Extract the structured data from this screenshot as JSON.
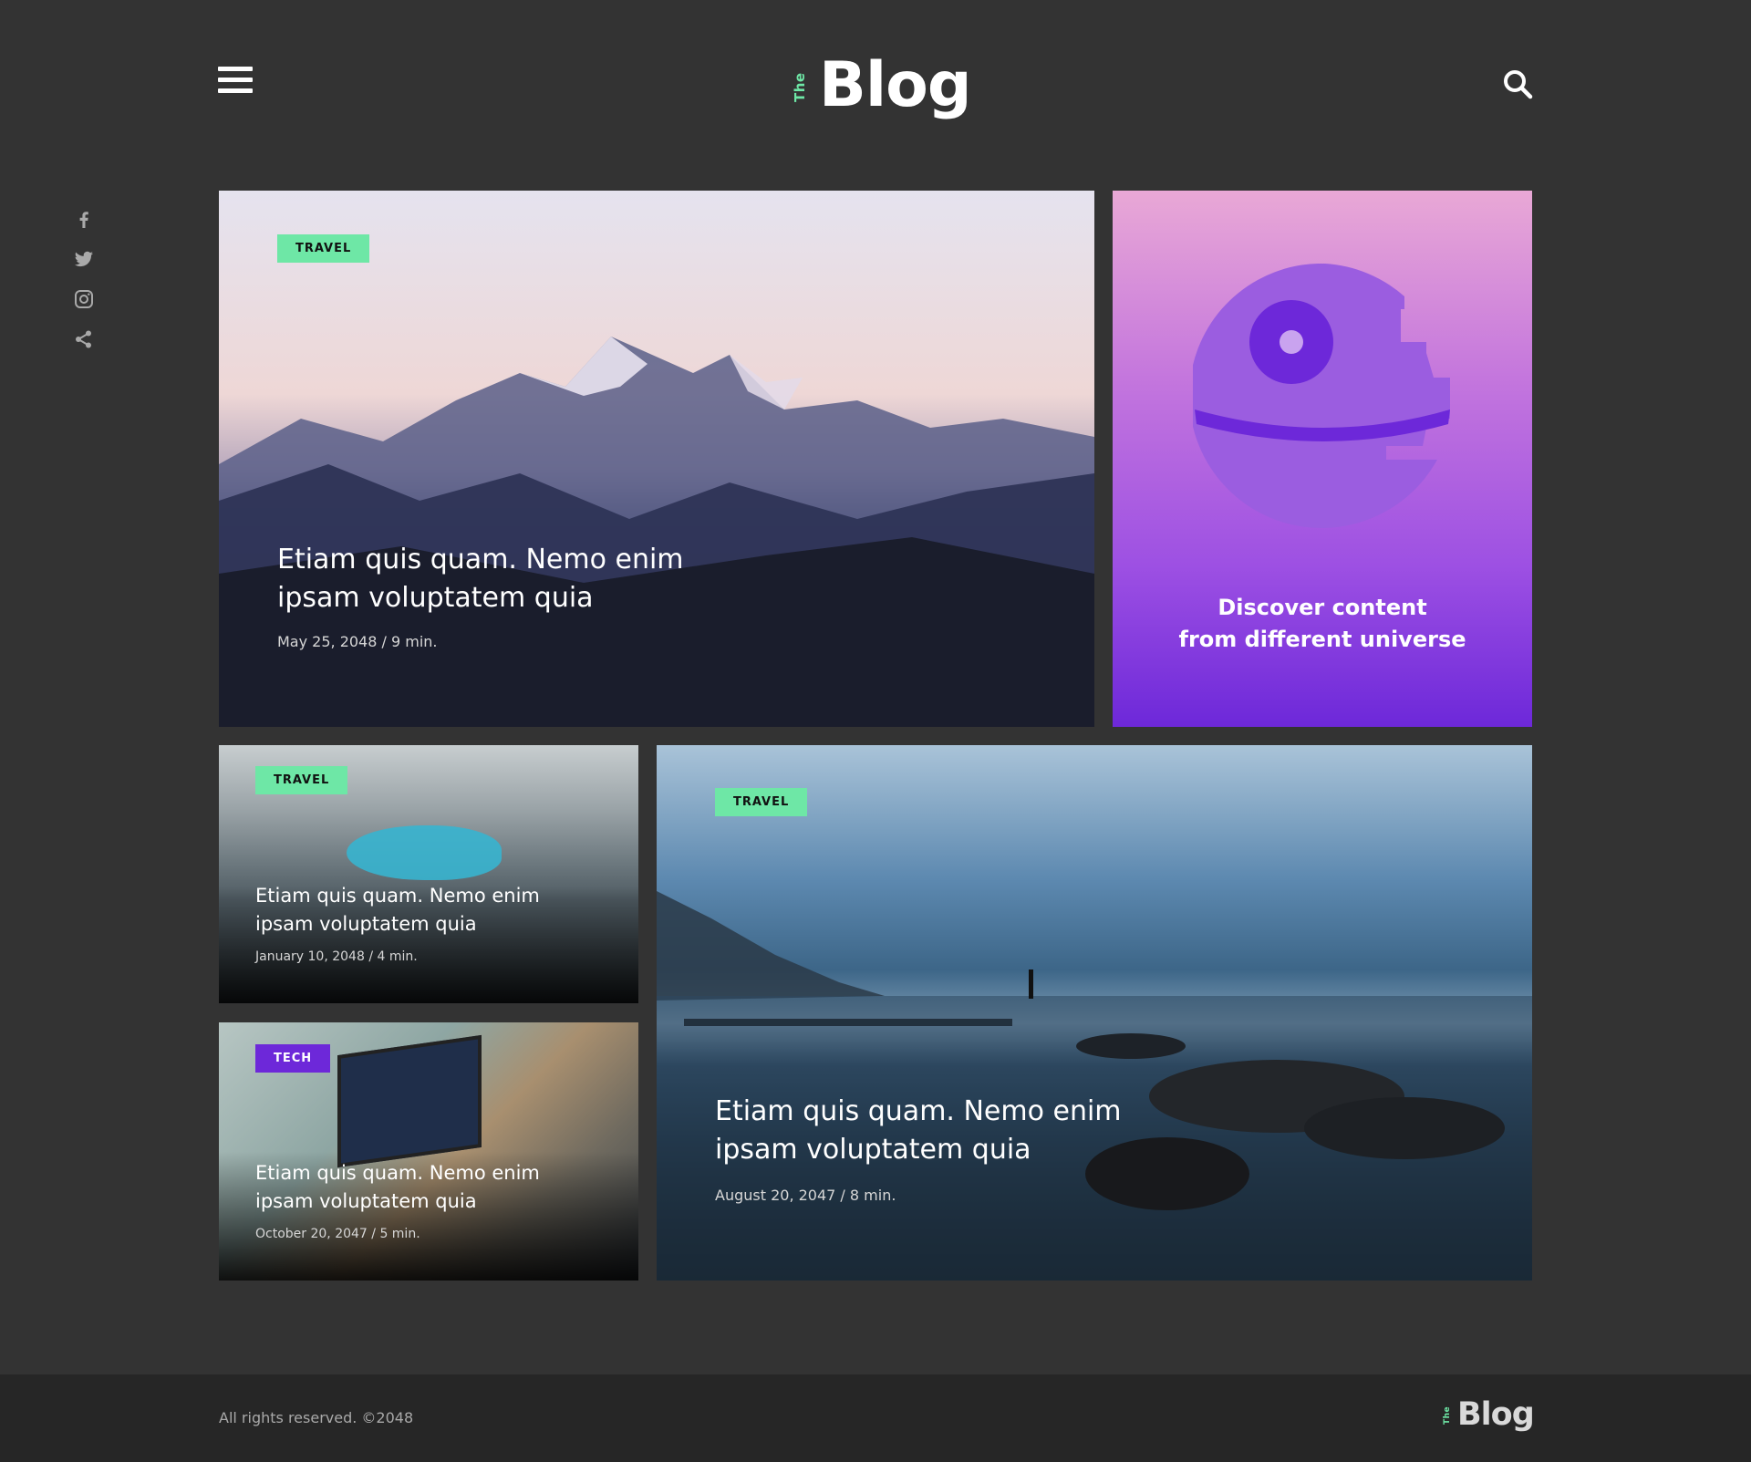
{
  "header": {
    "logo_small": "The",
    "logo_main": "Blog"
  },
  "social": [
    "facebook-icon",
    "twitter-icon",
    "instagram-icon",
    "share-icon"
  ],
  "posts": [
    {
      "category": "TRAVEL",
      "title": "Etiam quis quam. Nemo enim ipsam voluptatem quia",
      "meta": "May 25, 2048 / 9 min."
    },
    {
      "category": "TRAVEL",
      "title": "Etiam quis quam. Nemo enim ipsam voluptatem quia",
      "meta": "January 10, 2048 / 4 min."
    },
    {
      "category": "TECH",
      "title": "Etiam quis quam. Nemo enim ipsam voluptatem quia",
      "meta": "October 20, 2047 / 5 min."
    },
    {
      "category": "TRAVEL",
      "title": "Etiam quis quam. Nemo enim ipsam voluptatem quia",
      "meta": "August 20, 2047 / 8 min."
    }
  ],
  "promo": {
    "line1": "Discover content",
    "line2": "from different universe"
  },
  "footer": {
    "copyright": "All rights reserved. ©2048",
    "logo_small": "The",
    "logo_main": "Blog"
  },
  "colors": {
    "background": "#333333",
    "accent_green": "#6ee7a6",
    "accent_purple": "#6d28d9",
    "footer_bg": "#262626"
  }
}
